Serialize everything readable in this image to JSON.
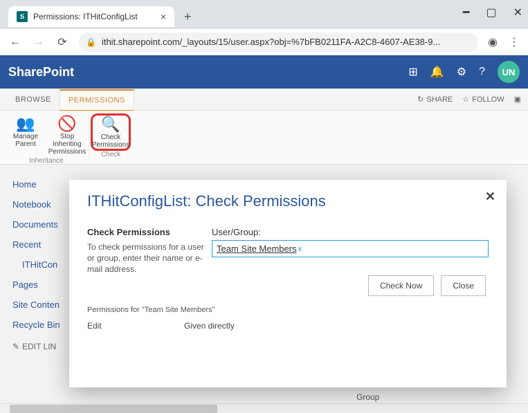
{
  "browser": {
    "tab_title": "Permissions: ITHitConfigList",
    "url": "ithit.sharepoint.com/_layouts/15/user.aspx?obj=%7bFB0211FA-A2C8-4607-AE38-9..."
  },
  "sp_header": {
    "brand": "SharePoint",
    "avatar_initials": "UN"
  },
  "tabs": {
    "browse": "BROWSE",
    "permissions": "PERMISSIONS",
    "share": "SHARE",
    "follow": "FOLLOW"
  },
  "ribbon": {
    "manage_parent": "Manage\nParent",
    "stop_inheriting": "Stop Inheriting\nPermissions",
    "check_permissions": "Check\nPermissions",
    "group_inheritance": "Inheritance",
    "group_check": "Check"
  },
  "sidebar": {
    "items": [
      "Home",
      "Notebook",
      "Documents",
      "Recent",
      "ITHitCon",
      "Pages",
      "Site Conten",
      "Recycle Bin"
    ],
    "edit_links": "EDIT LIN"
  },
  "main_footer_label": "Group",
  "dialog": {
    "title": "ITHitConfigList: Check Permissions",
    "section_heading": "Check Permissions",
    "section_desc": "To check permissions for a user or group, enter their name or e-mail address.",
    "user_group_label": "User/Group:",
    "token": "Team Site Members",
    "btn_check": "Check Now",
    "btn_close": "Close",
    "result_heading": "Permissions for \"Team Site Members\"",
    "result_level": "Edit",
    "result_given": "Given directly"
  }
}
